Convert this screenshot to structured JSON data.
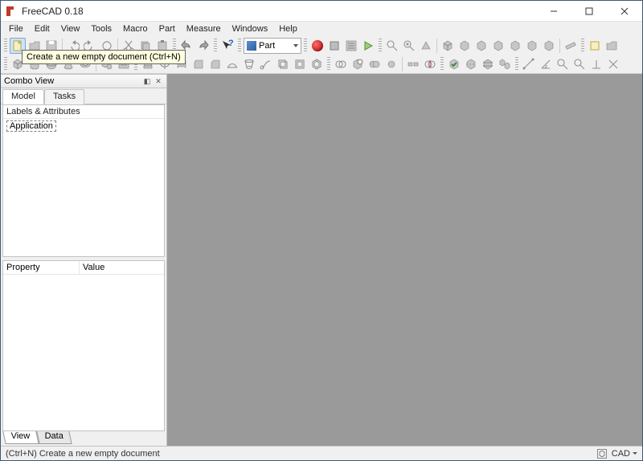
{
  "titlebar": {
    "title": "FreeCAD 0.18"
  },
  "menu": [
    "File",
    "Edit",
    "View",
    "Tools",
    "Macro",
    "Part",
    "Measure",
    "Windows",
    "Help"
  ],
  "tooltip": "Create a new empty document (Ctrl+N)",
  "workbench": {
    "label": "Part"
  },
  "combo_view": {
    "title": "Combo View",
    "tabs": [
      "Model",
      "Tasks"
    ],
    "tree_header": "Labels & Attributes",
    "tree_root": "Application",
    "prop_cols": [
      "Property",
      "Value"
    ],
    "bottom_tabs": [
      "View",
      "Data"
    ]
  },
  "statusbar": {
    "hint": "(Ctrl+N) Create a new empty document",
    "nav_style": "CAD"
  }
}
